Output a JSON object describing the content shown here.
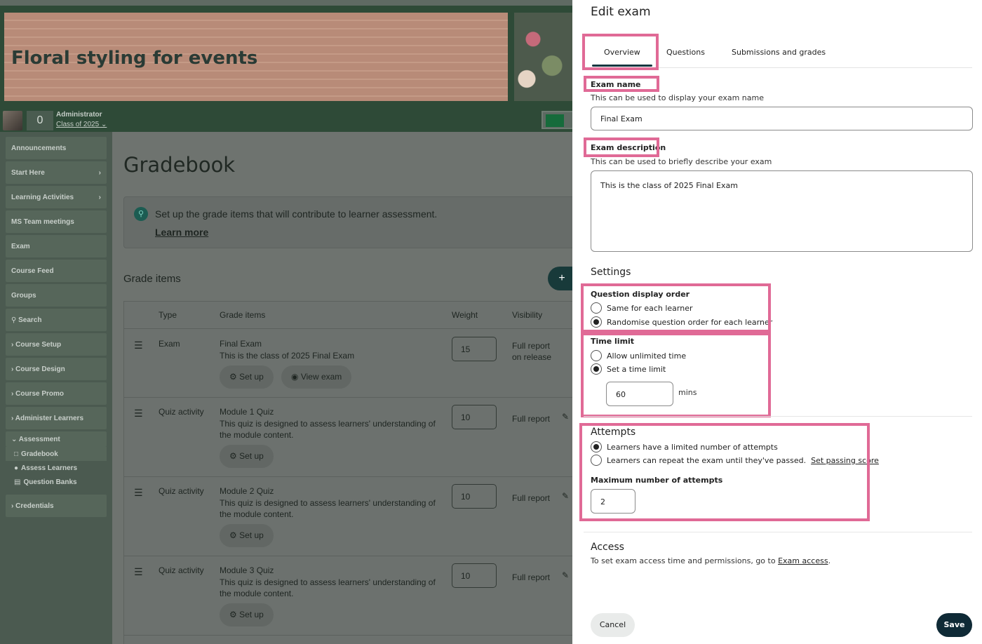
{
  "course": {
    "title": "Floral styling for events",
    "points": "0",
    "user_role": "Administrator",
    "user_class": "Class of 2025"
  },
  "sidebar": {
    "items": [
      {
        "label": "Announcements"
      },
      {
        "label": "Start Here"
      },
      {
        "label": "Learning Activities"
      },
      {
        "label": "MS Team meetings"
      },
      {
        "label": "Exam"
      },
      {
        "label": "Course Feed"
      },
      {
        "label": "Groups"
      },
      {
        "label": "Search"
      },
      {
        "label": "Course Setup"
      },
      {
        "label": "Course Design"
      },
      {
        "label": "Course Promo"
      },
      {
        "label": "Administer Learners"
      },
      {
        "label": "Assessment"
      },
      {
        "label": "Gradebook"
      },
      {
        "label": "Assess Learners"
      },
      {
        "label": "Question Banks"
      },
      {
        "label": "Credentials"
      }
    ]
  },
  "gradebook": {
    "title": "Gradebook",
    "info_text": "Set up the grade items that will contribute to learner assessment.",
    "info_link": "Learn more",
    "grade_items_title": "Grade items",
    "add_label": "+",
    "columns": {
      "type": "Type",
      "items": "Grade items",
      "weight": "Weight",
      "visibility": "Visibility"
    },
    "rows": [
      {
        "type": "Exam",
        "name": "Final Exam",
        "desc": "This is the class of 2025 Final Exam",
        "weight": "15",
        "visibility": "Full report on release",
        "setup": "Set up",
        "view": "View exam"
      },
      {
        "type": "Quiz activity",
        "name": "Module 1 Quiz",
        "desc": "This quiz is designed to assess learners' understanding of the module content.",
        "weight": "10",
        "visibility": "Full report",
        "setup": "Set up"
      },
      {
        "type": "Quiz activity",
        "name": "Module 2 Quiz",
        "desc": "This quiz is designed to assess learners' understanding of the module content.",
        "weight": "10",
        "visibility": "Full report",
        "setup": "Set up"
      },
      {
        "type": "Quiz activity",
        "name": "Module 3 Quiz",
        "desc": "This quiz is designed to assess learners' understanding of the module content.",
        "weight": "10",
        "visibility": "Full report",
        "setup": "Set up"
      }
    ]
  },
  "panel": {
    "title": "Edit exam",
    "tabs": [
      "Overview",
      "Questions",
      "Submissions and grades"
    ],
    "exam_name": {
      "label": "Exam name",
      "hint": "This can be used to display your exam name",
      "value": "Final Exam"
    },
    "exam_description": {
      "label": "Exam description",
      "hint": "This can be used to briefly describe your exam",
      "value": "This is the class of 2025 Final Exam"
    },
    "settings_title": "Settings",
    "question_order": {
      "label": "Question display order",
      "opt1": "Same for each learner",
      "opt2": "Randomise question order for each learner"
    },
    "time_limit": {
      "label": "Time limit",
      "opt1": "Allow unlimited time",
      "opt2": "Set a time limit",
      "value": "60",
      "unit": "mins"
    },
    "attempts": {
      "title": "Attempts",
      "opt1": "Learners have a limited number of attempts",
      "opt2": "Learners can repeat the exam until they've passed.",
      "opt2_link": "Set passing score",
      "max_label": "Maximum number of attempts",
      "max_value": "2"
    },
    "access": {
      "title": "Access",
      "text": "To set exam access time and permissions, go to",
      "link": "Exam access",
      "end": "."
    },
    "cancel": "Cancel",
    "save": "Save"
  },
  "colors": {
    "highlight": "#e06a96",
    "primary": "#0f2a36"
  }
}
